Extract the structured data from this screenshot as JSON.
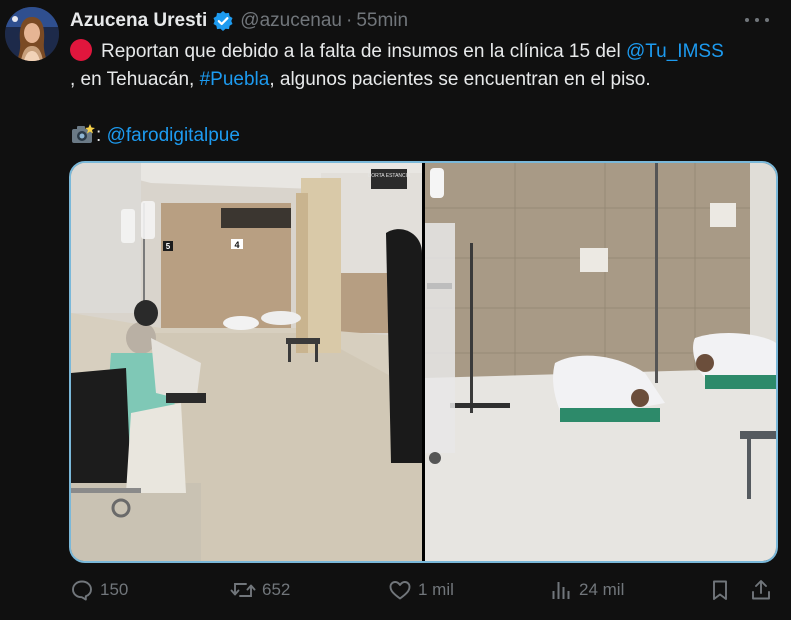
{
  "tweet": {
    "display_name": "Azucena Uresti",
    "handle": "@azucenau",
    "separator": "·",
    "time": "55min",
    "text": {
      "line1_before": "Reportan que debido a la falta de insumos en la clínica 15 del ",
      "mention_imss": "@Tu_IMSS",
      "line2_before": ", en Tehuacán, ",
      "hashtag": "#Puebla",
      "line2_after": ", algunos pacientes se encuentran en el piso.",
      "photo_credit_sep": ": ",
      "photo_credit": "@farodigitalpue"
    },
    "media": {
      "sign_label": "CORTA ESTANCIA",
      "room_number_1": "4",
      "room_number_2": "5"
    },
    "actions": {
      "replies": "150",
      "reposts": "652",
      "likes": "1 mil",
      "views": "24 mil"
    }
  },
  "colors": {
    "background": "#101010",
    "text": "#e7e9ea",
    "muted": "#71767b",
    "link": "#1d9bf0",
    "verified": "#1d9bf0",
    "red_circle": "#e0163d",
    "media_border": "#7ab8d9"
  },
  "icons": {
    "verified": "verified-badge-icon",
    "red_circle": "red-circle-icon",
    "camera": "camera-flash-icon",
    "more": "more-dots-icon",
    "reply": "reply-icon",
    "repost": "repost-icon",
    "like": "heart-icon",
    "views": "views-bar-chart-icon",
    "bookmark": "bookmark-icon",
    "share": "share-icon"
  }
}
